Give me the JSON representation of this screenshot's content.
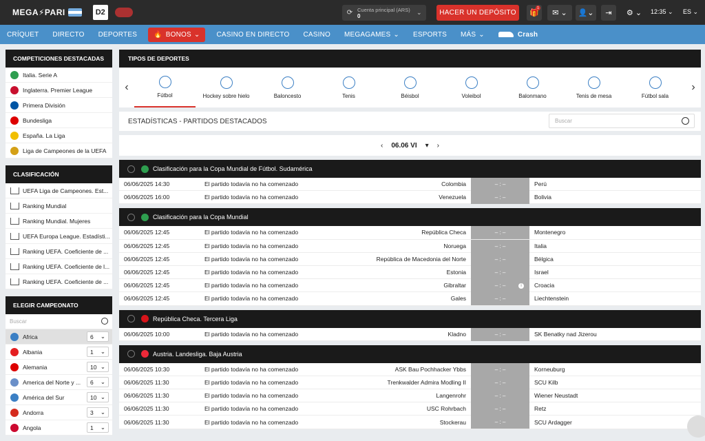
{
  "header": {
    "logo": "MEGA⚡PARI",
    "dota_label": "D2",
    "account_label": "Cuenta principal (ARS)",
    "account_balance": "0",
    "deposit_label": "HACER UN DEPÓSITO",
    "gift_badge": "1",
    "time": "12:35",
    "lang": "ES"
  },
  "nav": {
    "items": [
      "CRÍQUET",
      "DIRECTO",
      "DEPORTES"
    ],
    "bonos": "BONOS",
    "items2": [
      "CASINO EN DIRECTO",
      "CASINO",
      "MEGAGAMES",
      "ESPORTS",
      "MÁS"
    ],
    "crash": "Crash"
  },
  "featured": {
    "title": "COMPETICIONES DESTACADAS",
    "items": [
      {
        "label": "Italia. Serie A",
        "color": "#2e9e4f"
      },
      {
        "label": "Inglaterra. Premier League",
        "color": "#c8102e"
      },
      {
        "label": "Primera División",
        "color": "#0055a4"
      },
      {
        "label": "Bundesliga",
        "color": "#dd0000"
      },
      {
        "label": "España. La Liga",
        "color": "#f1bf00"
      },
      {
        "label": "Liga de Campeones de la UEFA",
        "color": "#d4a017"
      }
    ]
  },
  "ranking": {
    "title": "CLASIFICACIÓN",
    "items": [
      "UEFA Liga de Campeones. Est...",
      "Ranking Mundial",
      "Ranking Mundial. Mujeres",
      "UEFA Europa League. Estadísti...",
      "Ranking UEFA. Coeficiente de ...",
      "Ranking UEFA. Coeficiente de l...",
      "Ranking UEFA. Coeficiente de ..."
    ]
  },
  "champ": {
    "title": "ELEGIR CAMPEONATO",
    "search_placeholder": "Buscar",
    "items": [
      {
        "name": "Africa",
        "count": "6",
        "color": "#3b7fc4"
      },
      {
        "name": "Albania",
        "count": "1",
        "color": "#e41e20"
      },
      {
        "name": "Alemania",
        "count": "10",
        "color": "#dd0000"
      },
      {
        "name": "America del Norte y ...",
        "count": "6",
        "color": "#6a8fc8"
      },
      {
        "name": "América del Sur",
        "count": "10",
        "color": "#3b7fc4"
      },
      {
        "name": "Andorra",
        "count": "3",
        "color": "#d52b1e"
      },
      {
        "name": "Angola",
        "count": "1",
        "color": "#cc092f"
      }
    ]
  },
  "sports": {
    "title": "TIPOS DE DEPORTES",
    "items": [
      "Fútbol",
      "Hockey sobre hielo",
      "Baloncesto",
      "Tenis",
      "Béisbol",
      "Voleibol",
      "Balonmano",
      "Tenis de mesa",
      "Fútbol sala"
    ]
  },
  "stats": {
    "title": "ESTADÍSTICAS - PARTIDOS DESTACADOS",
    "search_placeholder": "Buscar",
    "date": "06.06 VI"
  },
  "leagues": [
    {
      "name": "Clasificación para la Copa Mundial de Fútbol. Sudamérica",
      "color": "#2e9e4f",
      "matches": [
        {
          "date": "06/06/2025 14:30",
          "status": "El partido todavía no ha comenzado",
          "home": "Colombia",
          "score": "– : –",
          "away": "Perú"
        },
        {
          "date": "06/06/2025 16:00",
          "status": "El partido todavía no ha comenzado",
          "home": "Venezuela",
          "score": "– : –",
          "away": "Bolivia"
        }
      ]
    },
    {
      "name": "Clasificación para la Copa Mundial",
      "color": "#2e9e4f",
      "matches": [
        {
          "date": "06/06/2025 12:45",
          "status": "El partido todavía no ha comenzado",
          "home": "República Checa",
          "score": "– : –",
          "away": "Montenegro"
        },
        {
          "date": "06/06/2025 12:45",
          "status": "El partido todavía no ha comenzado",
          "home": "Noruega",
          "score": "– : –",
          "away": "Italia"
        },
        {
          "date": "06/06/2025 12:45",
          "status": "El partido todavía no ha comenzado",
          "home": "República de Macedonia del Norte",
          "score": "– : –",
          "away": "Bélgica"
        },
        {
          "date": "06/06/2025 12:45",
          "status": "El partido todavía no ha comenzado",
          "home": "Estonia",
          "score": "– : –",
          "away": "Israel"
        },
        {
          "date": "06/06/2025 12:45",
          "status": "El partido todavía no ha comenzado",
          "home": "Gibraltar",
          "score": "– : –",
          "away": "Croacia",
          "info": true
        },
        {
          "date": "06/06/2025 12:45",
          "status": "El partido todavía no ha comenzado",
          "home": "Gales",
          "score": "– : –",
          "away": "Liechtenstein"
        }
      ]
    },
    {
      "name": "República Checa. Tercera Liga",
      "color": "#d7141a",
      "matches": [
        {
          "date": "06/06/2025 10:00",
          "status": "El partido todavía no ha comenzado",
          "home": "Kladno",
          "score": "– : –",
          "away": "SK Benatky nad Jizerou"
        }
      ]
    },
    {
      "name": "Austria. Landesliga. Baja Austria",
      "color": "#ed2939",
      "matches": [
        {
          "date": "06/06/2025 10:30",
          "status": "El partido todavía no ha comenzado",
          "home": "ASK Bau Pochhacker Ybbs",
          "score": "– : –",
          "away": "Korneuburg"
        },
        {
          "date": "06/06/2025 11:30",
          "status": "El partido todavía no ha comenzado",
          "home": "Trenkwalder Admira Modling II",
          "score": "– : –",
          "away": "SCU Kilb"
        },
        {
          "date": "06/06/2025 11:30",
          "status": "El partido todavía no ha comenzado",
          "home": "Langenrohr",
          "score": "– : –",
          "away": "Wiener Neustadt"
        },
        {
          "date": "06/06/2025 11:30",
          "status": "El partido todavía no ha comenzado",
          "home": "USC Rohrbach",
          "score": "– : –",
          "away": "Retz"
        },
        {
          "date": "06/06/2025 11:30",
          "status": "El partido todavía no ha comenzado",
          "home": "Stockerau",
          "score": "– : –",
          "away": "SCU Ardagger"
        }
      ]
    }
  ]
}
